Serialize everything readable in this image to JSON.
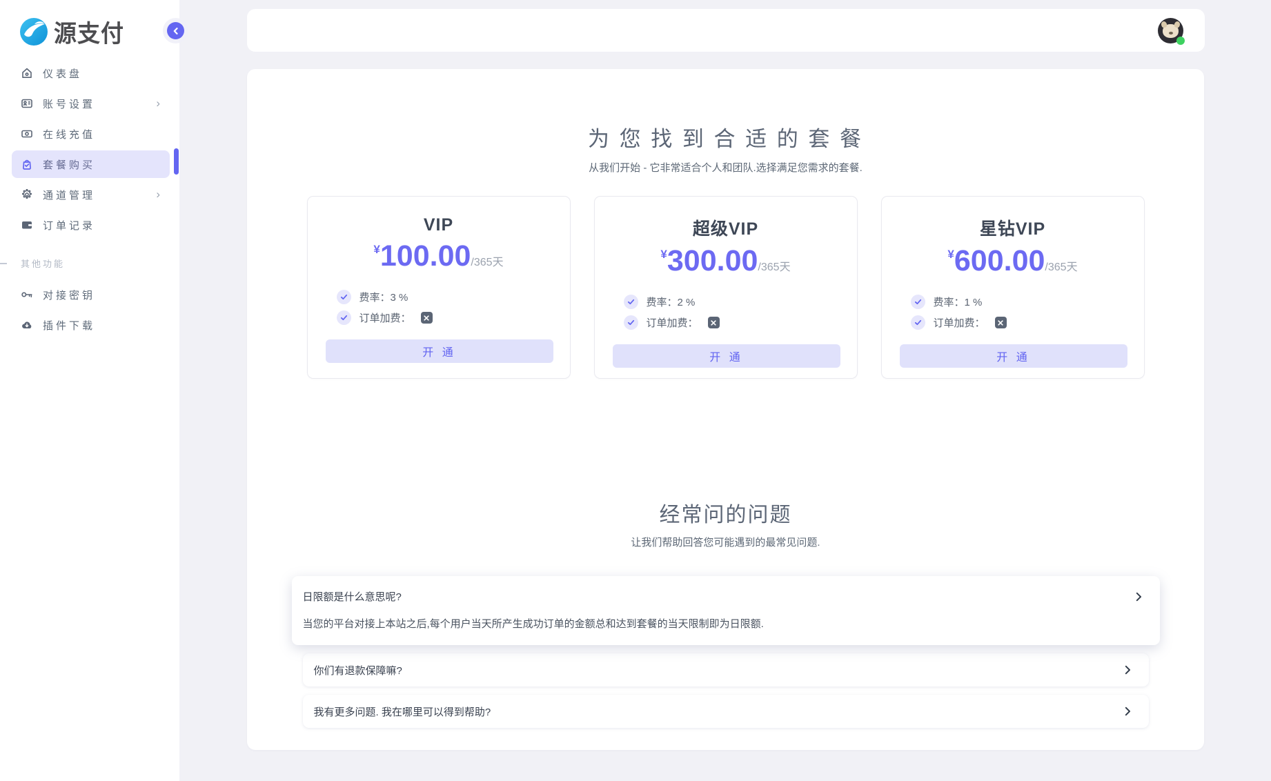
{
  "brand": {
    "logo_text": "源支付"
  },
  "sidebar": {
    "menu": [
      {
        "label": "仪表盘",
        "icon": "home-icon"
      },
      {
        "label": "账号设置",
        "icon": "id-card-icon",
        "chevron": "›"
      },
      {
        "label": "在线充值",
        "icon": "banknote-icon"
      },
      {
        "label": "套餐购买",
        "icon": "shopping-bag-icon",
        "active": true
      },
      {
        "label": "通道管理",
        "icon": "gear-icon",
        "chevron": "›"
      },
      {
        "label": "订单记录",
        "icon": "wallet-icon"
      }
    ],
    "section_label": "其他功能",
    "extra_menu": [
      {
        "label": "对接密钥",
        "icon": "key-icon"
      },
      {
        "label": "插件下载",
        "icon": "cloud-download-icon"
      }
    ]
  },
  "pricing": {
    "title": "为 您 找 到 合 适 的 套 餐",
    "subtitle": "从我们开始 - 它非常适合个人和团队.选择满足您需求的套餐.",
    "currency": "¥",
    "period": "/365天",
    "open_label": "开 通",
    "plans": [
      {
        "name": "VIP",
        "price": "100.00",
        "rate": "费率：3 %",
        "surcharge": "订单加费："
      },
      {
        "name": "超级VIP",
        "price": "300.00",
        "rate": "费率：2 %",
        "surcharge": "订单加费："
      },
      {
        "name": "星钻VIP",
        "price": "600.00",
        "rate": "费率：1 %",
        "surcharge": "订单加费："
      }
    ]
  },
  "faq": {
    "title": "经常问的问题",
    "subtitle": "让我们帮助回答您可能遇到的最常见问题.",
    "items": [
      {
        "question": "日限额是什么意思呢?",
        "answer": "当您的平台对接上本站之后,每个用户当天所产生成功订单的金额总和达到套餐的当天限制即为日限额.",
        "expanded": true
      },
      {
        "question": "你们有退款保障嘛?"
      },
      {
        "question": "我有更多问题. 我在哪里可以得到帮助?"
      }
    ]
  },
  "colors": {
    "accent": "#6366f1",
    "price": "#6c6af2",
    "button_bg": "#e0e1fb",
    "active_item_bg": "#e4e4fc",
    "background": "#f1f1f6",
    "status_online": "#3ed160",
    "logo_blue": "#1f9fe0"
  }
}
